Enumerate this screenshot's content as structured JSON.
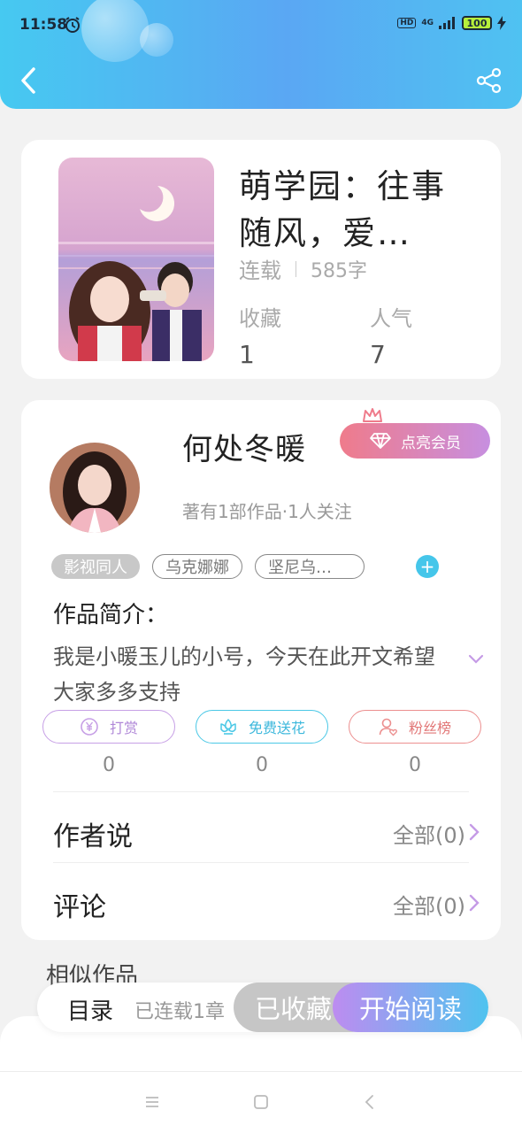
{
  "status_bar": {
    "time": "11:58",
    "network": "4G",
    "battery": "100"
  },
  "book": {
    "title": "萌学园：往事随风，爱…",
    "status": "连载",
    "word_count": "585字",
    "stats": [
      {
        "label": "收藏",
        "value": "1"
      },
      {
        "label": "人气",
        "value": "7"
      }
    ]
  },
  "author": {
    "name": "何处冬暖",
    "vip_label": "点亮会员",
    "stats": "著有1部作品·1人关注"
  },
  "tags": [
    "影视同人",
    "乌克娜娜",
    "坚尼乌…"
  ],
  "intro": {
    "title": "作品简介：",
    "text": "我是小暖玉儿的小号，今天在此开文希望大家多多支持"
  },
  "actions": [
    {
      "label": "打赏",
      "count": "0"
    },
    {
      "label": "免费送花",
      "count": "0"
    },
    {
      "label": "粉丝榜",
      "count": "0"
    }
  ],
  "rows": [
    {
      "label": "作者说",
      "value": "全部(0)"
    },
    {
      "label": "评论",
      "value": "全部(0)"
    }
  ],
  "similar_title": "相似作品",
  "bottom_bar": {
    "toc": "目录",
    "toc_count": "已连载1章",
    "collected": "已收藏",
    "read": "开始阅读"
  },
  "colors": {
    "header_start": "#46c9f1",
    "header_end": "#5aa7f3",
    "accent_cyan": "#45c6ea",
    "accent_purple": "#bd8cf0",
    "vip_pink": "#ef7b8b"
  }
}
